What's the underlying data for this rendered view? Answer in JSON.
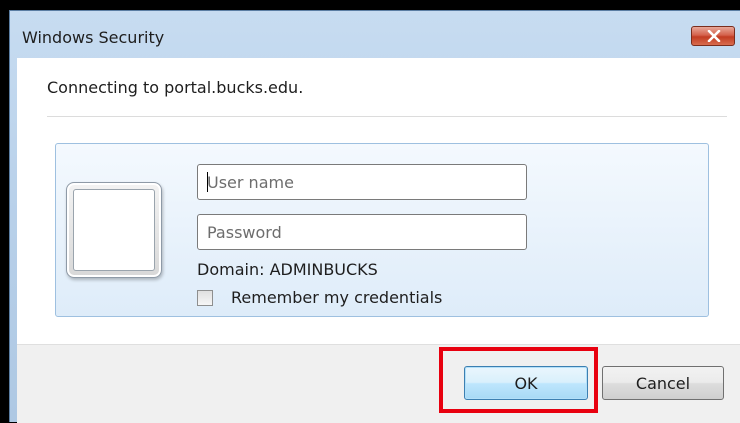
{
  "window": {
    "title": "Windows Security",
    "close_icon": "close-icon"
  },
  "message": {
    "connecting": "Connecting to portal.bucks.edu."
  },
  "credentials": {
    "user_placeholder": "User name",
    "password_placeholder": "Password",
    "domain": "Domain: ADMINBUCKS",
    "remember_label": "Remember my credentials",
    "remember_checked": false
  },
  "buttons": {
    "ok": "OK",
    "cancel": "Cancel"
  },
  "colors": {
    "highlight": "#e8000f",
    "close_button": "#c23c22",
    "panel_border": "#9ec0e0"
  }
}
